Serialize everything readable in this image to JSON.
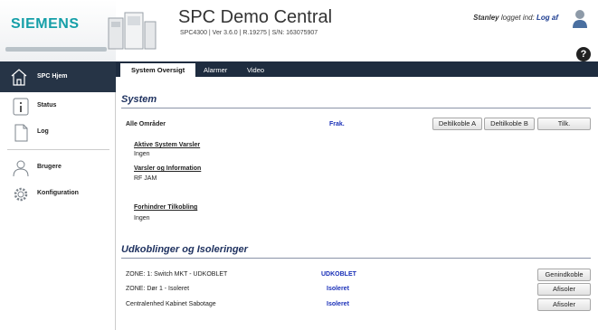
{
  "header": {
    "brand": "SIEMENS",
    "title": "SPC Demo Central",
    "subtitle": "SPC4300 | Ver 3.6.0 | R.19275 | S/N: 163075907",
    "user_name": "Stanley",
    "logged_in_text": "logget ind:",
    "logout_label": "Log af"
  },
  "tabs": [
    {
      "label": "System Oversigt",
      "active": true
    },
    {
      "label": "Alarmer",
      "active": false
    },
    {
      "label": "Video",
      "active": false
    }
  ],
  "sidebar": {
    "items": [
      {
        "label": "SPC Hjem",
        "icon": "home-icon"
      },
      {
        "label": "Status",
        "icon": "info-icon"
      },
      {
        "label": "Log",
        "icon": "document-icon"
      },
      {
        "label": "Brugere",
        "icon": "users-icon"
      },
      {
        "label": "Konfiguration",
        "icon": "gear-icon"
      }
    ]
  },
  "system": {
    "title": "System",
    "area_label": "Alle Områder",
    "area_status": "Frak.",
    "buttons": [
      "Deltilkoble A",
      "Deltilkoble B",
      "Tilk."
    ],
    "warnings_heading": "Aktive System Varsler",
    "warnings_value": "Ingen",
    "info_heading": "Varsler og Information",
    "info_value": "RF JAM",
    "prevent_heading": "Forhindrer Tilkobling",
    "prevent_value": "Ingen"
  },
  "isolations": {
    "title": "Udkoblinger og Isoleringer",
    "rows": [
      {
        "name": "ZONE: 1: Switch MKT - UDKOBLET",
        "status": "UDKOBLET",
        "action": "Genindkoble"
      },
      {
        "name": "ZONE: Dør 1 - Isoleret",
        "status": "Isoleret",
        "action": "Afisoler"
      },
      {
        "name": "Centralenhed Kabinet Sabotage",
        "status": "Isoleret",
        "action": "Afisoler"
      }
    ]
  },
  "colors": {
    "nav_bg": "#1e2c3f",
    "brand": "#159fa8",
    "section_title": "#1f3260",
    "status_blue": "#1a30b8"
  }
}
